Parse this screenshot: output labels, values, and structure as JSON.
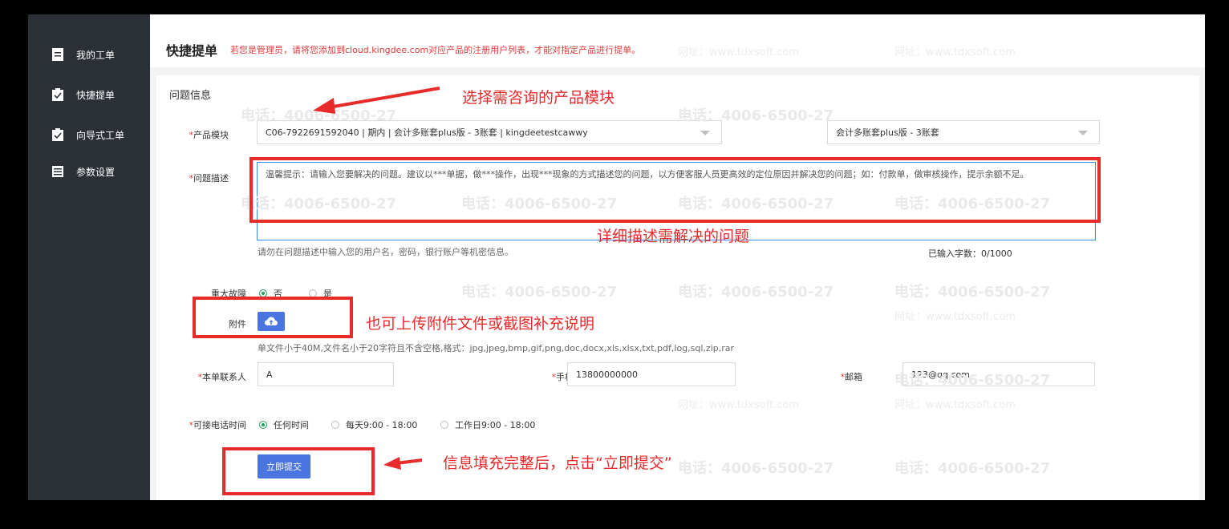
{
  "sidebar": {
    "items": [
      {
        "label": "我的工单",
        "icon": "list-icon"
      },
      {
        "label": "快捷提单",
        "icon": "clipboard-icon"
      },
      {
        "label": "向导式工单",
        "icon": "clipboard-icon"
      },
      {
        "label": "参数设置",
        "icon": "settings-list-icon"
      }
    ]
  },
  "header": {
    "title": "快捷提单",
    "notice": "若您是管理员，请将您添加到cloud.kingdee.com对应产品的注册用户列表，才能对指定产品进行提单。"
  },
  "form": {
    "section_title": "问题信息",
    "product_label": "产品模块",
    "product_value": "C06-7922691592040 | 期内 | 会计多账套plus版 - 3账套 | kingdeetestcawwy",
    "product_sub_value": "会计多账套plus版 - 3账套",
    "desc_label": "问题描述",
    "desc_placeholder": "温馨提示：请输入您要解决的问题。建议以***单据，做***操作，出现***现象的方式描述您的问题，以方便客服人员更高效的定位原因并解决您的问题；如：付款单，做审核操作，提示余额不足。",
    "desc_hint": "请勿在问题描述中输入您的用户名，密码，银行账户等机密信息。",
    "char_count": "已输入字数：0/1000",
    "major_label": "重大故障",
    "major_options": [
      "否",
      "是"
    ],
    "attach_label": "附件",
    "attach_hint": "单文件小于40M,文件名小于20字符且不含空格,格式：jpg,jpeg,bmp,gif,png,doc,docx,xls,xlsx,txt,pdf,log,sql,zip,rar",
    "contact_label": "本单联系人",
    "contact_value": "A",
    "phone_label": "手机",
    "phone_value": "13800000000",
    "email_label": "邮箱",
    "email_value": "123@qq.com",
    "time_label": "可接电话时间",
    "time_options": [
      "任何时间",
      "每天9:00 - 18:00",
      "工作日9:00 - 18:00"
    ],
    "submit_label": "立即提交"
  },
  "annotations": {
    "product": "选择需咨询的产品模块",
    "desc": "详细描述需解决的问题",
    "attach": "也可上传附件文件或截图补充说明",
    "submit": "信息填充完整后，点击“立即提交”"
  },
  "watermark": {
    "phone": "电话：4006-6500-27",
    "site": "网址：www.tdxsoft.com"
  },
  "colors": {
    "accent": "#4a74e0",
    "annotation": "#e72a2a",
    "sidebar_bg": "#2b2f36"
  }
}
